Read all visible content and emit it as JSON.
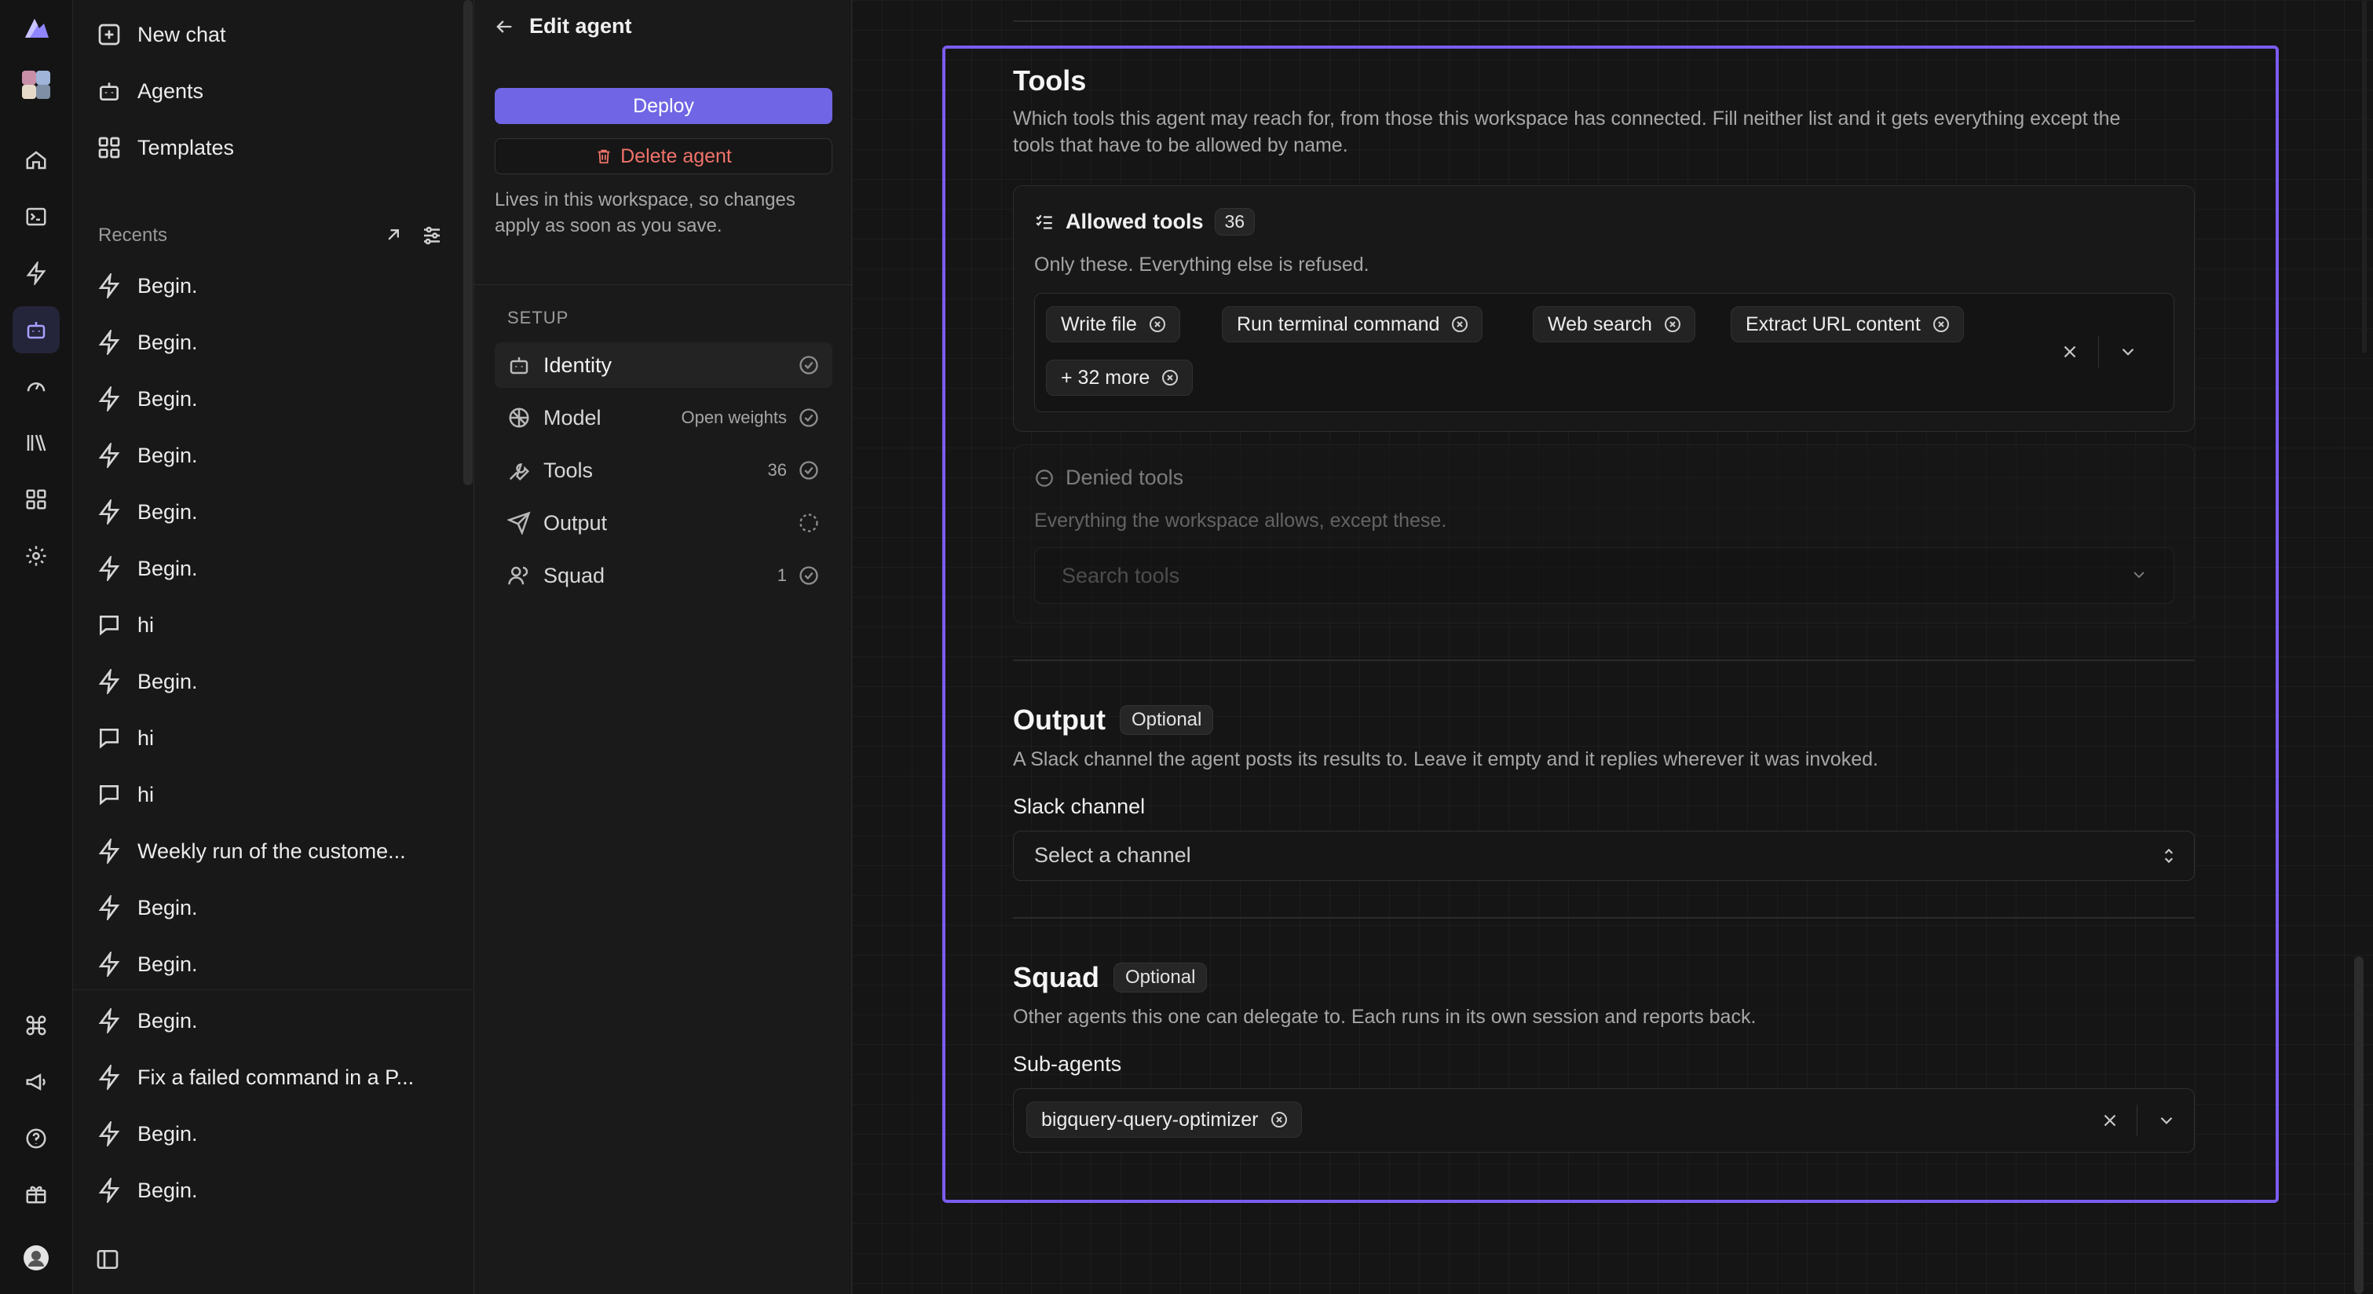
{
  "nav": {
    "new_chat": "New chat",
    "agents": "Agents",
    "templates": "Templates"
  },
  "recents": {
    "label": "Recents",
    "items": [
      {
        "icon": "bolt-icon",
        "label": "Begin."
      },
      {
        "icon": "bolt-icon",
        "label": "Begin."
      },
      {
        "icon": "bolt-icon",
        "label": "Begin."
      },
      {
        "icon": "bolt-icon",
        "label": "Begin."
      },
      {
        "icon": "bolt-icon",
        "label": "Begin."
      },
      {
        "icon": "bolt-icon",
        "label": "Begin."
      },
      {
        "icon": "chat-bubble-icon",
        "label": "hi"
      },
      {
        "icon": "bolt-icon",
        "label": "Begin."
      },
      {
        "icon": "chat-bubble-icon",
        "label": "hi"
      },
      {
        "icon": "chat-bubble-icon",
        "label": "hi"
      },
      {
        "icon": "bolt-icon",
        "label": "Weekly run of the custome..."
      },
      {
        "icon": "bolt-icon",
        "label": "Begin."
      },
      {
        "icon": "bolt-icon",
        "label": "Begin."
      },
      {
        "icon": "bolt-icon",
        "label": "Begin."
      },
      {
        "icon": "bolt-icon",
        "label": "Fix a failed command in a P..."
      },
      {
        "icon": "bolt-icon",
        "label": "Begin."
      },
      {
        "icon": "bolt-icon",
        "label": "Begin."
      }
    ]
  },
  "panel": {
    "title": "Edit agent",
    "deploy": "Deploy",
    "delete": "Delete agent",
    "note": "Lives in this workspace, so changes apply as soon as you save.",
    "setup_label": "SETUP",
    "steps": [
      {
        "label": "Identity",
        "meta": "",
        "status": "done"
      },
      {
        "label": "Model",
        "meta": "Open weights",
        "status": "done"
      },
      {
        "label": "Tools",
        "meta": "36",
        "status": "done"
      },
      {
        "label": "Output",
        "meta": "",
        "status": "pending"
      },
      {
        "label": "Squad",
        "meta": "1",
        "status": "done"
      }
    ]
  },
  "tools": {
    "title": "Tools",
    "description": "Which tools this agent may reach for, from those this workspace has connected. Fill neither list and it gets everything except the tools that have to be allowed by name.",
    "allowed": {
      "title": "Allowed tools",
      "count": "36",
      "subtitle": "Only these. Everything else is refused.",
      "tags": [
        "Write file",
        "Run terminal command",
        "Web search",
        "Extract URL content",
        "+ 32 more"
      ]
    },
    "denied": {
      "title": "Denied tools",
      "subtitle": "Everything the workspace allows, except these.",
      "placeholder": "Search tools"
    }
  },
  "output": {
    "title": "Output",
    "badge": "Optional",
    "description": "A Slack channel the agent posts its results to. Leave it empty and it replies wherever it was invoked.",
    "field_label": "Slack channel",
    "placeholder": "Select a channel"
  },
  "squad": {
    "title": "Squad",
    "badge": "Optional",
    "description": "Other agents this one can delegate to. Each runs in its own session and reports back.",
    "field_label": "Sub-agents",
    "tags": [
      "bigquery-query-optimizer"
    ]
  },
  "colors": {
    "accent": "#7065e4",
    "highlight_border": "#7b5cf0",
    "danger": "#f1736a",
    "background": "#151515"
  }
}
